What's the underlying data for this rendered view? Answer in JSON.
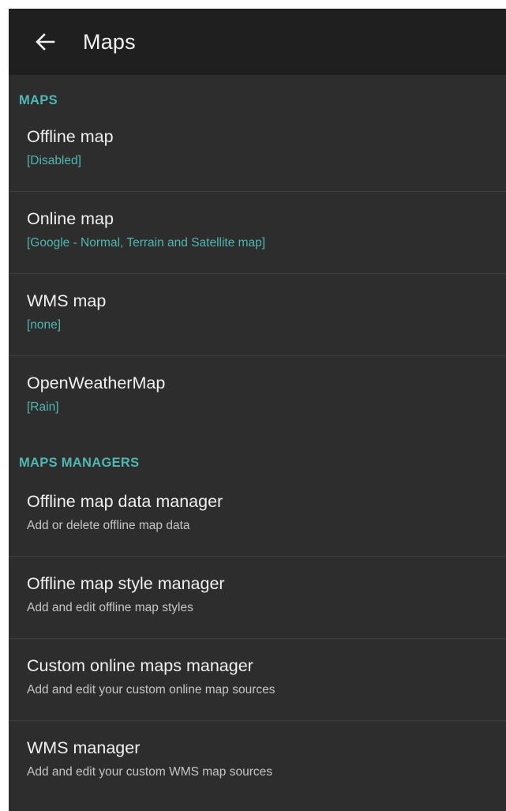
{
  "appbar": {
    "title": "Maps",
    "back_icon": "arrow-left-icon"
  },
  "sections": [
    {
      "header": "MAPS",
      "items": [
        {
          "title": "Offline map",
          "summary": "[Disabled]"
        },
        {
          "title": "Online map",
          "summary": "[Google - Normal, Terrain and Satellite map]"
        },
        {
          "title": "WMS map",
          "summary": "[none]"
        },
        {
          "title": "OpenWeatherMap",
          "summary": "[Rain]"
        }
      ]
    },
    {
      "header": "MAPS MANAGERS",
      "items": [
        {
          "title": "Offline map data manager",
          "summary": "Add or delete offline map data"
        },
        {
          "title": "Offline map style manager",
          "summary": "Add and edit offline map styles"
        },
        {
          "title": "Custom online maps manager",
          "summary": "Add and edit your custom online map sources"
        },
        {
          "title": "WMS manager",
          "summary": "Add and edit your custom WMS map sources"
        }
      ]
    }
  ],
  "colors": {
    "background": "#2d2d2d",
    "appbar": "#1f1f1f",
    "accent": "#4fb8b1",
    "divider": "#3e3e3e"
  }
}
